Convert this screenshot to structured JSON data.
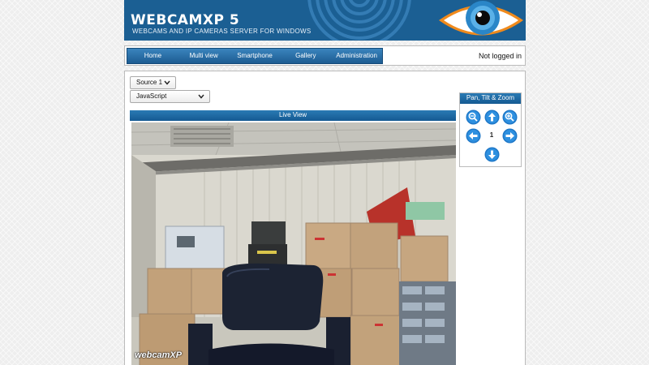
{
  "header": {
    "title": "WEBCAMXP 5",
    "subtitle": "WEBCAMS AND IP CAMERAS SERVER FOR WINDOWS",
    "brand_color": "#1b5f93"
  },
  "nav": {
    "items": [
      {
        "label": "Home"
      },
      {
        "label": "Multi view"
      },
      {
        "label": "Smartphone"
      },
      {
        "label": "Gallery"
      },
      {
        "label": "Administration"
      }
    ]
  },
  "login_status": "Not logged in",
  "controls": {
    "source_selected": "Source 1",
    "mode_selected": "JavaScript"
  },
  "live_view": {
    "title": "Live View",
    "watermark": "webcamXP"
  },
  "ptz": {
    "title": "Pan, Tilt & Zoom",
    "preset_number": "1",
    "icons": [
      "zoom-out-icon",
      "arrow-up-icon",
      "zoom-in-icon",
      "arrow-left-icon",
      "arrow-right-icon",
      "arrow-down-icon"
    ]
  }
}
